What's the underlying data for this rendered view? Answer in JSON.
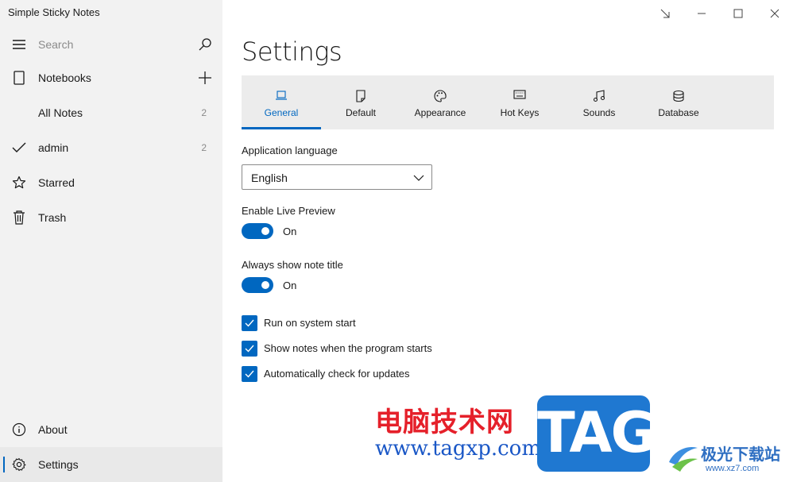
{
  "app": {
    "title": "Simple Sticky Notes"
  },
  "sidebar": {
    "search_placeholder": "Search",
    "items": [
      {
        "label": "Notebooks",
        "icon": "notebook-icon",
        "action_icon": "plus-icon"
      },
      {
        "label": "All Notes",
        "count": "2"
      },
      {
        "label": "admin",
        "count": "2",
        "icon": "checkmark-icon"
      },
      {
        "label": "Starred",
        "icon": "star-icon"
      },
      {
        "label": "Trash",
        "icon": "trash-icon"
      }
    ],
    "footer": [
      {
        "label": "About",
        "icon": "info-icon"
      },
      {
        "label": "Settings",
        "icon": "gear-icon",
        "selected": true
      }
    ]
  },
  "main": {
    "title": "Settings",
    "tabs": [
      {
        "label": "General",
        "icon": "laptop-icon",
        "active": true
      },
      {
        "label": "Default",
        "icon": "note-icon"
      },
      {
        "label": "Appearance",
        "icon": "palette-icon"
      },
      {
        "label": "Hot Keys",
        "icon": "keyboard-icon"
      },
      {
        "label": "Sounds",
        "icon": "music-icon"
      },
      {
        "label": "Database",
        "icon": "database-icon"
      }
    ],
    "language": {
      "label": "Application language",
      "value": "English"
    },
    "live_preview": {
      "label": "Enable Live Preview",
      "state": "On"
    },
    "note_title": {
      "label": "Always show note title",
      "state": "On"
    },
    "checkboxes": [
      {
        "label": "Run on system start",
        "checked": true
      },
      {
        "label": "Show notes when the program starts",
        "checked": true
      },
      {
        "label": "Automatically check for updates",
        "checked": true
      }
    ]
  },
  "watermark": {
    "cn_text": "电脑技术网",
    "url": "www.tagxp.com",
    "tag": "TAG",
    "site_cn": "极光下载站",
    "site_url": "www.xz7.com"
  },
  "colors": {
    "accent": "#0067c0",
    "sidebar_bg": "#f2f2f2",
    "tabbar_bg": "#ececec"
  }
}
